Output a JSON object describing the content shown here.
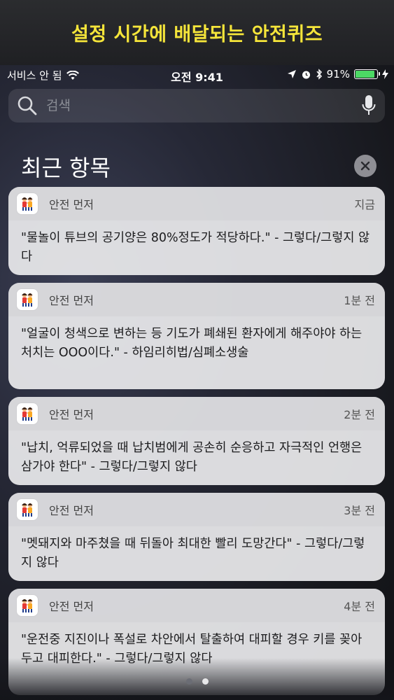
{
  "banner": {
    "title": "설정 시간에 배달되는 안전퀴즈"
  },
  "status_bar": {
    "carrier": "서비스 안 됨",
    "time": "오전 9:41",
    "battery_percent": "91%",
    "battery_level": 0.91,
    "battery_color": "#4cd964",
    "icons": [
      "wifi-icon",
      "location-icon",
      "alarm-icon",
      "bluetooth-icon",
      "charging-icon"
    ]
  },
  "search": {
    "placeholder": "검색"
  },
  "recent": {
    "title": "최근 항목"
  },
  "notifications": [
    {
      "app": "안전 먼저",
      "time": "지금",
      "text": "\"물놀이 튜브의 공기양은 80%정도가 적당하다.\" - 그렇다/그렇지 않다"
    },
    {
      "app": "안전 먼저",
      "time": "1분 전",
      "text": "\"얼굴이 청색으로 변하는 등 기도가 폐쇄된 환자에게 해주야야 하는 처치는 OOO이다.\" - 하임리히법/심폐소생술"
    },
    {
      "app": "안전 먼저",
      "time": "2분 전",
      "text": "\"납치, 억류되었을 때 납치범에게 공손히 순응하고 자극적인 언행은 삼가야 한다\" - 그렇다/그렇지 않다"
    },
    {
      "app": "안전 먼저",
      "time": "3분 전",
      "text": "\"멧돼지와 마주쳤을 때 뒤돌아 최대한 빨리 도망간다\" - 그렇다/그렇지 않다"
    },
    {
      "app": "안전 먼저",
      "time": "4분 전",
      "text": "\"운전중 지진이나 폭설로 차안에서 탈출하여 대피할 경우 키를 꽂아두고 대피한다.\" - 그렇다/그렇지 않다"
    }
  ],
  "pager": {
    "count": 2,
    "active": 2
  }
}
